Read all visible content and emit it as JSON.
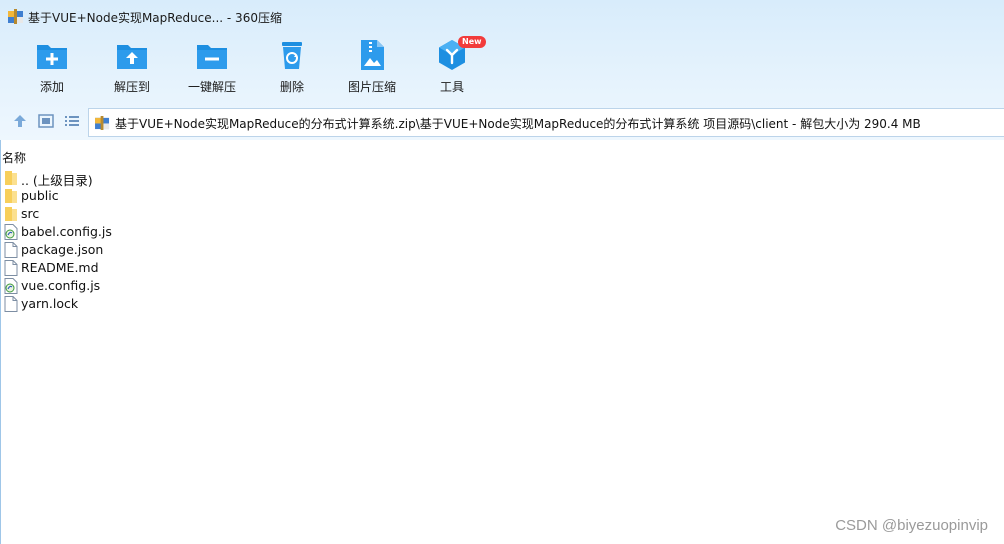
{
  "window": {
    "title": "基于VUE+Node实现MapReduce... - 360压缩"
  },
  "toolbar": {
    "items": [
      {
        "label": "添加",
        "icon": "add-folder-icon"
      },
      {
        "label": "解压到",
        "icon": "extract-to-folder-icon"
      },
      {
        "label": "一键解压",
        "icon": "one-click-extract-icon"
      },
      {
        "label": "删除",
        "icon": "recycle-bin-icon"
      },
      {
        "label": "图片压缩",
        "icon": "image-compress-icon"
      },
      {
        "label": "工具",
        "icon": "tools-icon",
        "badge": "New"
      }
    ]
  },
  "navbar": {
    "path": "基于VUE+Node实现MapReduce的分布式计算系统.zip\\基于VUE+Node实现MapReduce的分布式计算系统 项目源码\\client - 解包大小为 290.4 MB"
  },
  "filelist": {
    "column_name": "名称",
    "rows": [
      {
        "name": ".. (上级目录)",
        "type": "folder"
      },
      {
        "name": "public",
        "type": "folder"
      },
      {
        "name": "src",
        "type": "folder"
      },
      {
        "name": "babel.config.js",
        "type": "js"
      },
      {
        "name": "package.json",
        "type": "file"
      },
      {
        "name": "README.md",
        "type": "file"
      },
      {
        "name": "vue.config.js",
        "type": "js"
      },
      {
        "name": "yarn.lock",
        "type": "file"
      }
    ]
  },
  "watermark": "CSDN @biyezuopinvip",
  "colors": {
    "accent": "#1e90e0",
    "toolbar_bg": "#dcedfb",
    "badge": "#f23b3b",
    "folder": "#f7cf5a"
  }
}
